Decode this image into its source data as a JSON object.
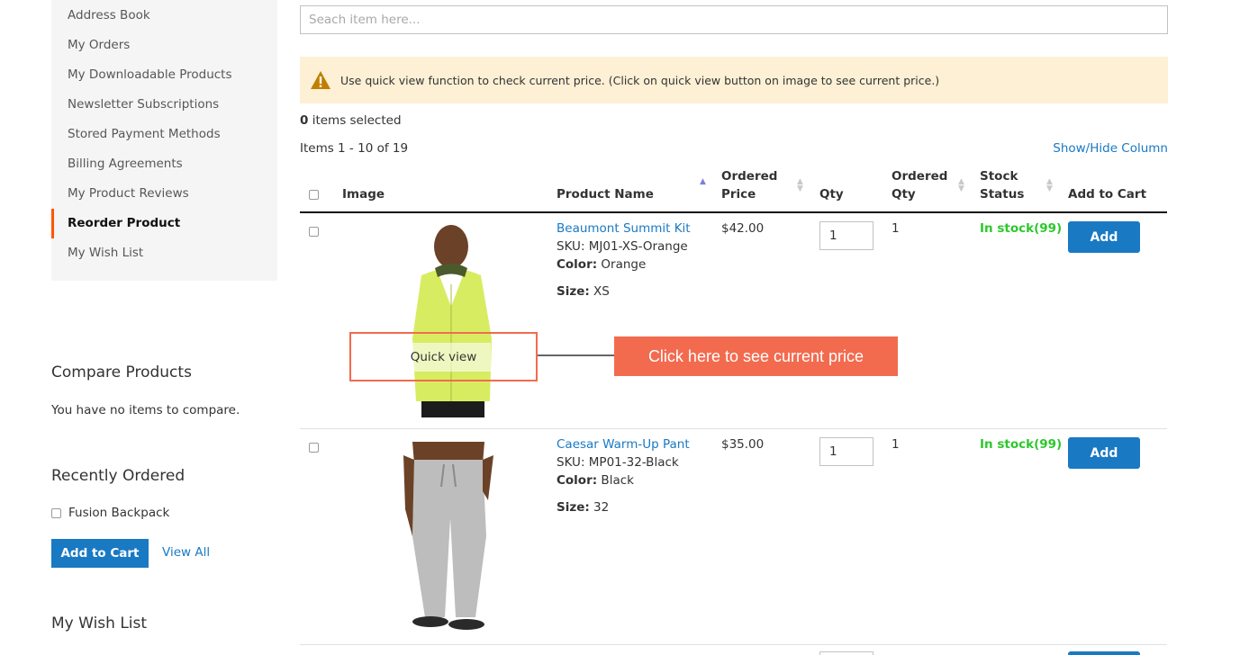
{
  "sidebar": {
    "nav_items": [
      {
        "label": "Address Book",
        "active": false
      },
      {
        "label": "My Orders",
        "active": false
      },
      {
        "label": "My Downloadable Products",
        "active": false
      },
      {
        "label": "Newsletter Subscriptions",
        "active": false
      },
      {
        "label": "Stored Payment Methods",
        "active": false
      },
      {
        "label": "Billing Agreements",
        "active": false
      },
      {
        "label": "My Product Reviews",
        "active": false
      },
      {
        "label": "Reorder Product",
        "active": true
      },
      {
        "label": "My Wish List",
        "active": false
      }
    ],
    "compare": {
      "title": "Compare Products",
      "empty_text": "You have no items to compare."
    },
    "recently_ordered": {
      "title": "Recently Ordered",
      "items": [
        {
          "label": "Fusion Backpack",
          "checked": false
        }
      ],
      "add_to_cart_label": "Add to Cart",
      "view_all_label": "View All"
    },
    "wishlist": {
      "title": "My Wish List"
    }
  },
  "main": {
    "search": {
      "placeholder": "Seach item here...",
      "value": ""
    },
    "notice": {
      "icon": "warning-icon",
      "text": "Use quick view function to check current price. (Click on quick view button on image to see current price.)"
    },
    "selected": {
      "count": "0",
      "suffix": " items selected"
    },
    "items_range": "Items 1 - 10 of 19",
    "show_hide_label": "Show/Hide Column",
    "columns": {
      "image": "Image",
      "product_name": "Product Name",
      "ordered_price_1": "Ordered",
      "ordered_price_2": "Price",
      "qty": "Qty",
      "ordered_qty_1": "Ordered",
      "ordered_qty_2": "Qty",
      "stock_status_1": "Stock",
      "stock_status_2": "Status",
      "add_to_cart": "Add to Cart"
    },
    "sort": {
      "column": "Product Name",
      "direction": "ascending"
    },
    "rows": [
      {
        "name": "Beaumont Summit Kit",
        "sku": "SKU: MJ01-XS-Orange",
        "color_label": "Color:",
        "color": " Orange",
        "size_label": "Size:",
        "size": " XS",
        "price": "$42.00",
        "qty": "1",
        "ordered_qty": "1",
        "stock": "In stock(99)",
        "add_label": "Add",
        "image": "lime-green-jacket-model"
      },
      {
        "name": "Caesar Warm-Up Pant",
        "sku": "SKU: MP01-32-Black",
        "color_label": "Color:",
        "color": " Black",
        "size_label": "Size:",
        "size": " 32",
        "price": "$35.00",
        "qty": "1",
        "ordered_qty": "1",
        "stock": "In stock(99)",
        "add_label": "Add",
        "image": "gray-sweatpants-model"
      }
    ],
    "quick_view_label": "Quick view",
    "callout_text": "Click here to see current price"
  },
  "colors": {
    "accent_blue": "#1979c3",
    "stock_green": "#2cc82c",
    "callout_orange": "#f26b4f",
    "active_nav_border": "#ff5501",
    "notice_bg": "#fdf0d5"
  }
}
